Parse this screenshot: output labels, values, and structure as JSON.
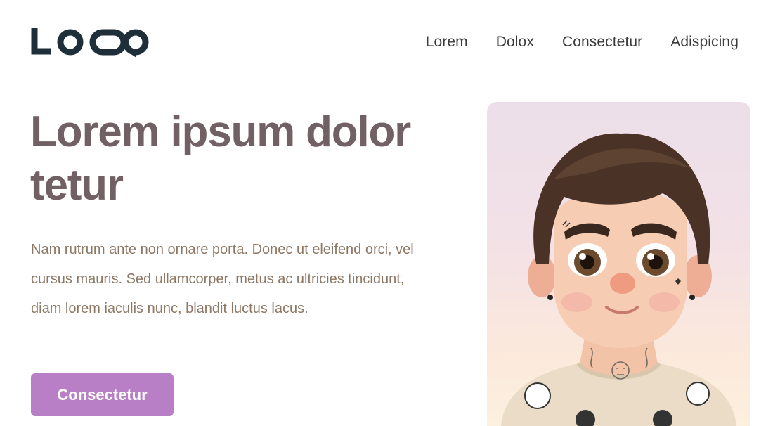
{
  "header": {
    "logo_text": "LOGO",
    "nav": [
      {
        "label": "Lorem"
      },
      {
        "label": "Dolox"
      },
      {
        "label": "Consectetur"
      },
      {
        "label": "Adispicing"
      }
    ]
  },
  "hero": {
    "title": "Lorem ipsum dolor tetur",
    "description": "Nam rutrum ante non ornare porta. Donec ut eleifend orci, vel cursus mauris. Sed ullamcorper, metus ac ultricies tincidunt, diam lorem iaculis nunc, blandit luctus lacus.",
    "cta_label": "Consectetur"
  },
  "colors": {
    "accent": "#b97fc6",
    "title": "#716064",
    "body_text": "#8c7864",
    "logo": "#1f2f3a"
  }
}
